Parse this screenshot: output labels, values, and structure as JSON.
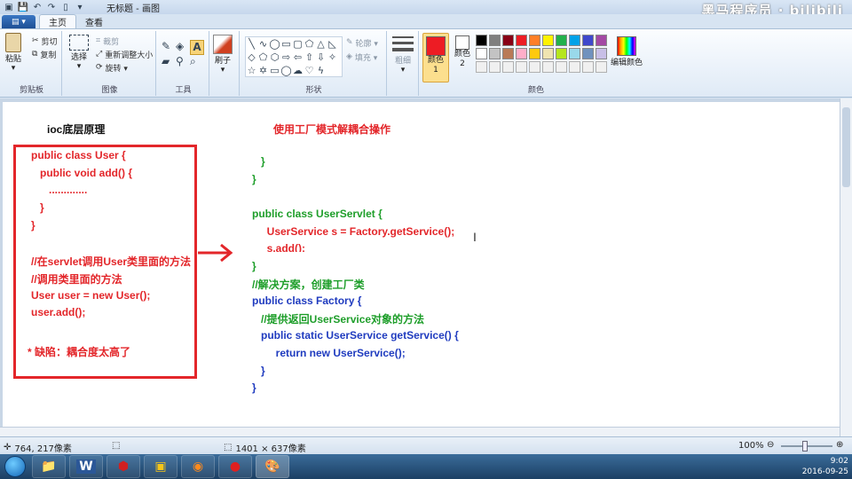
{
  "app": {
    "title": "无标题 - 画图",
    "watermark": "黑马程序员 · bilibili"
  },
  "tabs": {
    "menu_label": "▤ ▾",
    "home": "主页",
    "view": "查看"
  },
  "ribbon": {
    "clipboard": {
      "label": "剪贴板",
      "paste": "粘贴",
      "cut": "剪切",
      "copy": "复制"
    },
    "image": {
      "label": "图像",
      "select": "选择",
      "crop": "裁剪",
      "resize": "重新调整大小",
      "rotate": "旋转 ▾"
    },
    "tools": {
      "label": "工具"
    },
    "brushes": {
      "label": "刷子"
    },
    "shapes": {
      "label": "形状",
      "outline": "轮廓 ▾",
      "fill": "填充 ▾"
    },
    "size": {
      "label": "粗细"
    },
    "colors": {
      "label": "颜色",
      "color1": "颜色 1",
      "color2": "颜色 2",
      "edit": "编辑颜色"
    }
  },
  "palette": [
    "#000000",
    "#7f7f7f",
    "#880015",
    "#ed1c24",
    "#ff7f27",
    "#fff200",
    "#22b14c",
    "#00a2e8",
    "#3f48cc",
    "#a349a4",
    "#ffffff",
    "#c3c3c3",
    "#b97a57",
    "#ffaec9",
    "#ffc90e",
    "#efe4b0",
    "#b5e61d",
    "#99d9ea",
    "#7092be",
    "#c8bfe7"
  ],
  "canvas": {
    "heading": "ioc底层原理",
    "right_heading": "使用工厂模式解耦合操作",
    "left_code": [
      "public class User {",
      "   public void add() {",
      "      .............",
      "   }",
      "}",
      "",
      "//在servlet调用User类里面的方法",
      "//调用类里面的方法",
      "User user = new User();",
      "user.add();",
      "",
      "* 缺陷：耦合度太高了"
    ],
    "right_top": [
      "   }",
      "}"
    ],
    "servlet": [
      "public class UserServlet {",
      "     UserService s = Factory.getService();",
      "     s.add();",
      "}"
    ],
    "factory": [
      "//解决方案，创建工厂类",
      "public class Factory {",
      "   //提供返回UserService对象的方法",
      "   public static UserService getService() {",
      "        return new UserService();",
      "   }",
      "}"
    ]
  },
  "status": {
    "cursor": "764, 217像素",
    "size": "1401 × 637像素",
    "zoom": "100%"
  },
  "tray": {
    "time": "9:02",
    "date": "2016-09-25"
  }
}
